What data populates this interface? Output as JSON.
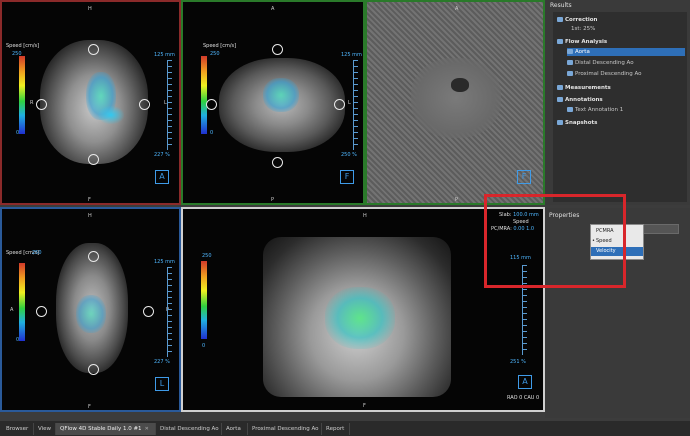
{
  "viewports": {
    "coronal": {
      "top": "H",
      "left": "R",
      "right": "L",
      "bottom": "F",
      "cb_title": "Speed [cm/s]",
      "cb_max": "250",
      "cb_min": "0",
      "mm": "125 mm",
      "pct": "227 %",
      "label": "A"
    },
    "axial": {
      "top": "A",
      "left": "R",
      "right": "L",
      "bottom": "P",
      "cb_title": "Speed [cm/s]",
      "cb_max": "250",
      "cb_min": "0",
      "mm": "125 mm",
      "pct": "250 %",
      "label": "F"
    },
    "phase": {
      "top": "A",
      "bottom": "P",
      "label": "F"
    },
    "sagittal": {
      "top": "H",
      "left": "A",
      "right": "P",
      "bottom": "F",
      "cb_title": "Speed [cm/s]",
      "cb_max": "250",
      "cb_min": "0",
      "mm": "125 mm",
      "pct": "227 %",
      "label": "L"
    },
    "volume": {
      "top": "H",
      "bottom": "F",
      "cb_max": "250",
      "cb_min": "0",
      "mm": "115 mm",
      "pct": "251 %",
      "label": "A",
      "orient": "RAO 0 CAU 0",
      "slab_label": "Slab:",
      "slab_value": "100.0 mm",
      "speed_label": "Speed",
      "pcmra_label": "PC/MRA:",
      "pcmra_value": "0.00 1.0"
    }
  },
  "results": {
    "title": "Results",
    "items": [
      {
        "label": "Correction",
        "type": "h"
      },
      {
        "label": "1st: 25%",
        "type": "c"
      },
      {
        "label": "Flow Analysis",
        "type": "h"
      },
      {
        "label": "Aorta",
        "type": "c"
      },
      {
        "label": "Distal Descending Ao",
        "type": "c"
      },
      {
        "label": "Proximal Descending Ao",
        "type": "c"
      },
      {
        "label": "Measurements",
        "type": "h"
      },
      {
        "label": "Annotations",
        "type": "h"
      },
      {
        "label": "Text Annotation 1",
        "type": "c"
      },
      {
        "label": "Snapshots",
        "type": "h"
      }
    ]
  },
  "properties": {
    "title": "Properties",
    "menu": [
      "PCMRA",
      "Speed",
      "Velocity"
    ],
    "selected": "Velocity",
    "checked": "Speed"
  },
  "tabs": [
    "Browser",
    "View",
    "QFlow 4D Stable Daily 1.0 #1",
    "Distal Descending Ao",
    "Aorta",
    "Proximal Descending Ao",
    "Report"
  ],
  "active_tab": "QFlow 4D Stable Daily 1.0 #1",
  "colors": {
    "accent": "#2e6fb8",
    "coronal_border": "#8b2a2a",
    "axial_border": "#2a7a2a",
    "phase_border": "#2a7a2a",
    "sagittal_border": "#2a5a9a",
    "volume_border": "#d0d0d0",
    "highlight": "#d8262b"
  }
}
